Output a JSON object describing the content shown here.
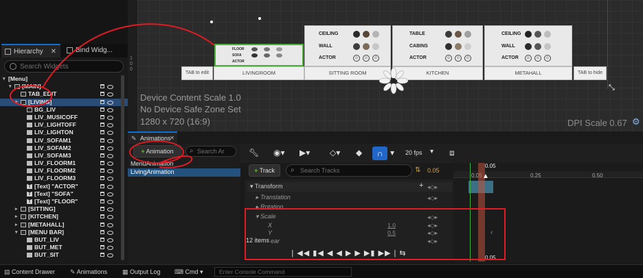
{
  "hierarchy": {
    "tab_hierarchy": "Hierarchy",
    "tab_bind": "Bind Widg...",
    "search_placeholder": "Search Widgets",
    "items": [
      {
        "label": "[Menu]",
        "depth": 0,
        "icon": "none",
        "expand": "open"
      },
      {
        "label": "[MAIN]",
        "depth": 1,
        "icon": "panel",
        "expand": "open"
      },
      {
        "label": "TAB_EDIT",
        "depth": 2,
        "icon": "image",
        "expand": "none"
      },
      {
        "label": "[LIVING]",
        "depth": 2,
        "icon": "panel",
        "expand": "open",
        "selected": true
      },
      {
        "label": "BG_LIV",
        "depth": 3,
        "icon": "image",
        "expand": "none"
      },
      {
        "label": "LIV_MUSICOFF",
        "depth": 3,
        "icon": "button",
        "expand": "none"
      },
      {
        "label": "LIV_LIGHTOFF",
        "depth": 3,
        "icon": "button",
        "expand": "none"
      },
      {
        "label": "LIV_LIGHTON",
        "depth": 3,
        "icon": "button",
        "expand": "none"
      },
      {
        "label": "LIV_SOFAM1",
        "depth": 3,
        "icon": "button",
        "expand": "none"
      },
      {
        "label": "LIV_SOFAM2",
        "depth": 3,
        "icon": "button",
        "expand": "none"
      },
      {
        "label": "LIV_SOFAM3",
        "depth": 3,
        "icon": "button",
        "expand": "none"
      },
      {
        "label": "LIV_FLOORM1",
        "depth": 3,
        "icon": "button",
        "expand": "none"
      },
      {
        "label": "LIV_FLOORM2",
        "depth": 3,
        "icon": "button",
        "expand": "none"
      },
      {
        "label": "LIV_FLOORM3",
        "depth": 3,
        "icon": "button",
        "expand": "none"
      },
      {
        "label": "[Text] \"ACTOR\"",
        "depth": 3,
        "icon": "text",
        "expand": "none"
      },
      {
        "label": "[Text] \"SOFA\"",
        "depth": 3,
        "icon": "text",
        "expand": "none"
      },
      {
        "label": "[Text] \"FLOOR\"",
        "depth": 3,
        "icon": "text",
        "expand": "none"
      },
      {
        "label": "[SITTING]",
        "depth": 2,
        "icon": "panel",
        "expand": "closed"
      },
      {
        "label": "[KITCHEN]",
        "depth": 2,
        "icon": "panel",
        "expand": "closed"
      },
      {
        "label": "[METAHALL]",
        "depth": 2,
        "icon": "panel",
        "expand": "closed"
      },
      {
        "label": "[MENU BAR]",
        "depth": 2,
        "icon": "panel",
        "expand": "open"
      },
      {
        "label": "BUT_LIV",
        "depth": 3,
        "icon": "button",
        "expand": "none"
      },
      {
        "label": "BUT_MET",
        "depth": 3,
        "icon": "button",
        "expand": "none"
      },
      {
        "label": "BUT_SIT",
        "depth": 3,
        "icon": "button",
        "expand": "none"
      }
    ]
  },
  "viewport": {
    "device_scale": "Device Content Scale 1.0",
    "safe_zone": "No Device Safe Zone Set",
    "resolution": "1280 x 720 (16:9)",
    "dpi": "DPI Scale 0.67",
    "ruler_labels": [
      "1",
      "0",
      "0"
    ],
    "tab_edit": "TAB to edit",
    "tab_hide": "TAB to hide",
    "rooms": [
      {
        "label": "LIVINGROOM",
        "rows": [
          "FLOOR",
          "SOFA",
          "ACTOR"
        ]
      },
      {
        "label": "SITTING ROOM",
        "rows": [
          "CEILING",
          "WALL",
          "ACTOR"
        ]
      },
      {
        "label": "KITCHEN",
        "rows": [
          "TABLE",
          "CABINS",
          "ACTOR"
        ]
      },
      {
        "label": "METAHALL",
        "rows": [
          "CEILING",
          "WALL",
          "ACTOR"
        ]
      }
    ]
  },
  "animations": {
    "tab": "Animations",
    "add_label": "Animation",
    "search_placeholder": "Search Ar",
    "list": [
      "MenuAnimation",
      "LivingAnimation"
    ],
    "fps": "20 fps",
    "time_value": "0.05",
    "track_label": "Track",
    "search_tracks": "Search Tracks",
    "tracks": [
      "Transform",
      "Translation",
      "Rotation",
      "Scale",
      "X",
      "Y",
      "ear"
    ],
    "x_value": "1.0",
    "y_value": "0.5",
    "item_count": "12 items",
    "ticks": [
      "0.05",
      "0.25",
      "0.50"
    ],
    "playhead": "0.05",
    "playback": "| ◀◀ ▮◀ ◀ ◀ ▶ ▶ ▶▮ ▶▶ | ⇆"
  },
  "status": {
    "content_drawer": "Content Drawer",
    "animations": "Animations",
    "output_log": "Output Log",
    "cmd": "Cmd",
    "console_placeholder": "Enter Console Command"
  }
}
